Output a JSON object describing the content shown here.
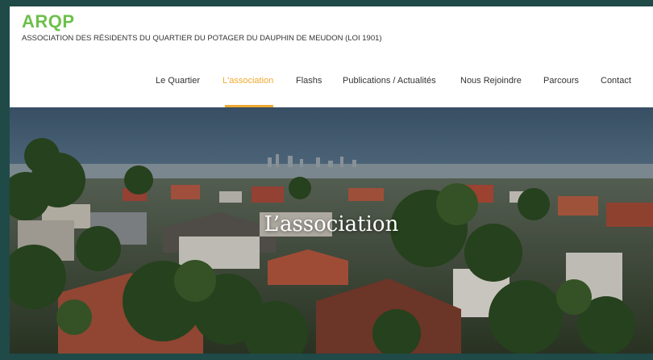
{
  "site": {
    "brand": "ARQP",
    "tagline": "ASSOCIATION DES RÉSIDENTS DU QUARTIER DU POTAGER DU DAUPHIN DE MEUDON (LOI 1901)"
  },
  "nav": {
    "items": [
      {
        "label": "Le Quartier",
        "active": false
      },
      {
        "label": "L'association",
        "active": true
      },
      {
        "label": "Flashs",
        "active": false
      },
      {
        "label": "Publications / Actualités",
        "active": false
      },
      {
        "label": "Nous Rejoindre",
        "active": false
      },
      {
        "label": "Parcours",
        "active": false
      },
      {
        "label": "Contact",
        "active": false
      }
    ]
  },
  "hero": {
    "title": "L’association"
  },
  "colors": {
    "brand_green": "#6dc04b",
    "accent_orange": "#f0a830",
    "frame_teal": "#1f4a48",
    "text_dark": "#333333"
  }
}
